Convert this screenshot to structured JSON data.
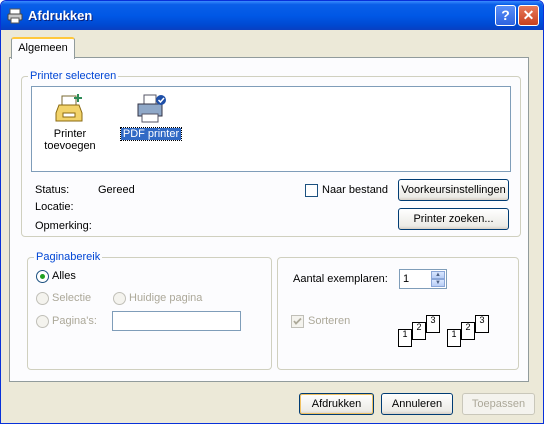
{
  "window": {
    "title": "Afdrukken",
    "help_glyph": "?",
    "close_glyph": "✕"
  },
  "tabs": [
    {
      "label": "Algemeen"
    }
  ],
  "printer_group": {
    "legend": "Printer selecteren",
    "printers": [
      {
        "label_line1": "Printer",
        "label_line2": "toevoegen",
        "icon": "add-printer-icon"
      },
      {
        "label_line1": "PDF printer",
        "icon": "printer-default-icon",
        "selected": true
      }
    ],
    "status_label": "Status:",
    "status_value": "Gereed",
    "location_label": "Locatie:",
    "comment_label": "Opmerking:",
    "print_to_file_label": "Naar bestand",
    "preferences_button": "Voorkeursinstellingen",
    "find_printer_button": "Printer zoeken..."
  },
  "page_range": {
    "legend": "Paginabereik",
    "all_label": "Alles",
    "selection_label": "Selectie",
    "current_page_label": "Huidige pagina",
    "pages_label": "Pagina's:",
    "pages_value": ""
  },
  "copies": {
    "label": "Aantal exemplaren:",
    "value": "1",
    "collate_label": "Sorteren",
    "collate_checked": true,
    "page_numbers": [
      "1",
      "2",
      "3"
    ]
  },
  "footer": {
    "print_button": "Afdrukken",
    "cancel_button": "Annuleren",
    "apply_button": "Toepassen"
  },
  "colors": {
    "title_blue": "#0058E6",
    "legend_blue": "#0046D5",
    "selection": "#316AC5",
    "dialog_bg": "#ECE9D8"
  }
}
